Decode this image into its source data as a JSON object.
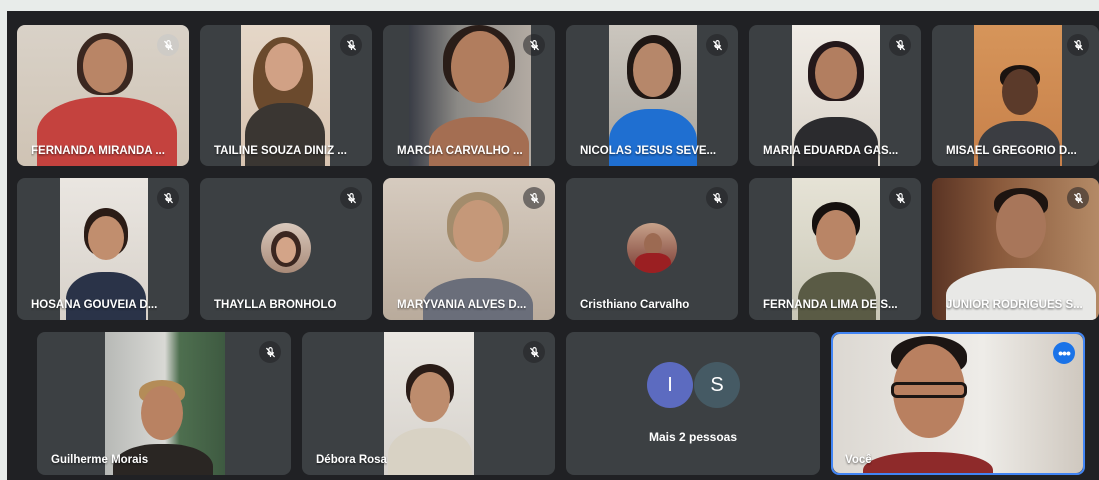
{
  "participants_row1": [
    {
      "name": "FERNANDA MIRANDA ...",
      "muted": true
    },
    {
      "name": "TAILINE SOUZA DINIZ ...",
      "muted": true
    },
    {
      "name": "MARCIA CARVALHO ...",
      "muted": true
    },
    {
      "name": "NICOLAS JESUS SEVE...",
      "muted": true
    },
    {
      "name": "MARIA EDUARDA GAS...",
      "muted": true
    },
    {
      "name": "MISAEL GREGORIO D...",
      "muted": true
    }
  ],
  "participants_row2": [
    {
      "name": "HOSANA GOUVEIA D...",
      "muted": true
    },
    {
      "name": "THAYLLA BRONHOLO",
      "muted": true
    },
    {
      "name": "MARYVANIA ALVES D...",
      "muted": true
    },
    {
      "name": "Cristhiano Carvalho",
      "muted": true
    },
    {
      "name": "FERNANDA LIMA DE S...",
      "muted": true
    },
    {
      "name": "JUNIOR RODRIGUES S...",
      "muted": true
    }
  ],
  "participants_row3": [
    {
      "name": "Guilherme Morais",
      "muted": true
    },
    {
      "name": "Débora Rosa",
      "muted": true
    }
  ],
  "more_people": {
    "avatars": [
      {
        "letter": "I",
        "color": "#5c6bc0"
      },
      {
        "letter": "S",
        "color": "#455a64"
      }
    ],
    "label": "Mais 2 pessoas"
  },
  "self_tile": {
    "name": "Você",
    "menu_icon": "more-horizontal-icon",
    "highlight_color": "#4285f4"
  },
  "colors": {
    "stage": "#202124",
    "tile": "#3c4043",
    "accent": "#1a73e8"
  }
}
